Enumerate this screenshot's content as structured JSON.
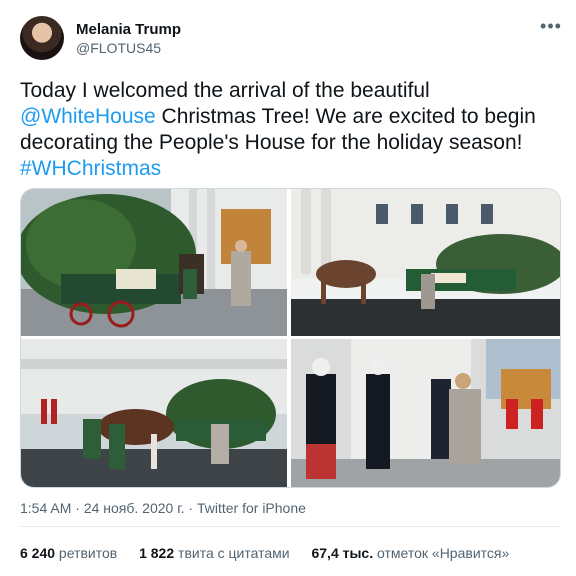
{
  "author": {
    "name": "Melania Trump",
    "handle": "@FLOTUS45"
  },
  "more_icon": "more-horizontal-icon",
  "tweet": {
    "text_before": "Today I welcomed the arrival of the beautiful ",
    "mention": "@WhiteHouse",
    "text_after": " Christmas Tree! We are excited to begin decorating the People's House for the holiday season! ",
    "hashtag": "#WHChristmas"
  },
  "meta": {
    "time": "1:54 AM",
    "sep1": " · ",
    "date": "24 нояб. 2020 г.",
    "sep2": " · ",
    "source": "Twitter for iPhone"
  },
  "stats": [
    {
      "num": "6 240",
      "label": " ретвитов"
    },
    {
      "num": "1 822",
      "label": " твита с цитатами"
    },
    {
      "num": "67,4 тыс.",
      "label": " отметок «Нравится»"
    }
  ],
  "colors": {
    "link": "#1d9bf0",
    "text": "#0f1419",
    "muted": "#536471"
  }
}
